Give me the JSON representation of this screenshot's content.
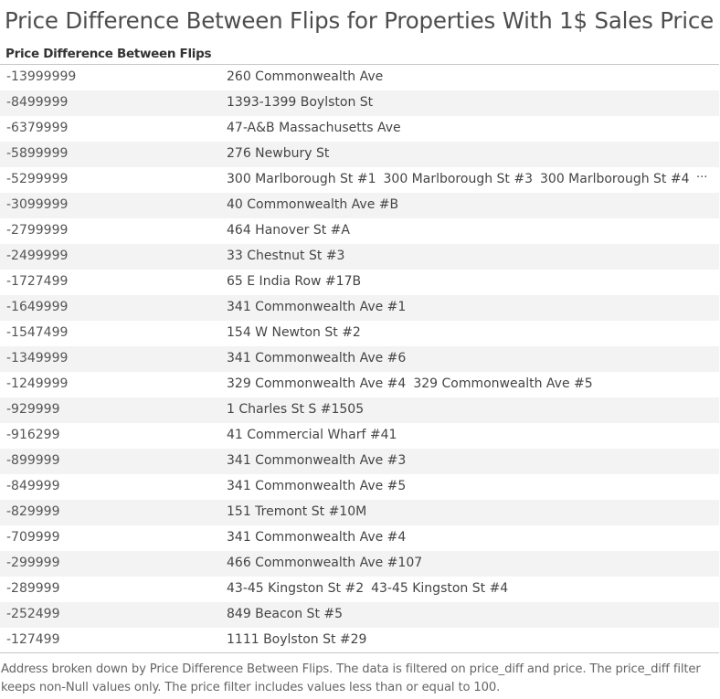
{
  "chart_data": {
    "type": "table",
    "title": "Price Difference Between Flips for Properties With 1$ Sales Price",
    "column_header": "Price Difference Between Flips",
    "rows": [
      {
        "diff": "-13999999",
        "addresses": [
          "260 Commonwealth Ave"
        ]
      },
      {
        "diff": "-8499999",
        "addresses": [
          "1393-1399 Boylston St"
        ]
      },
      {
        "diff": "-6379999",
        "addresses": [
          "47-A&B Massachusetts Ave"
        ]
      },
      {
        "diff": "-5899999",
        "addresses": [
          "276 Newbury St"
        ]
      },
      {
        "diff": "-5299999",
        "addresses": [
          "300 Marlborough St #1",
          "300 Marlborough St #3",
          "300 Marlborough St #4"
        ],
        "truncated": true
      },
      {
        "diff": "-3099999",
        "addresses": [
          "40 Commonwealth Ave #B"
        ]
      },
      {
        "diff": "-2799999",
        "addresses": [
          "464 Hanover St #A"
        ]
      },
      {
        "diff": "-2499999",
        "addresses": [
          "33 Chestnut St #3"
        ]
      },
      {
        "diff": "-1727499",
        "addresses": [
          "65 E India Row #17B"
        ]
      },
      {
        "diff": "-1649999",
        "addresses": [
          "341 Commonwealth Ave #1"
        ]
      },
      {
        "diff": "-1547499",
        "addresses": [
          "154 W Newton St #2"
        ]
      },
      {
        "diff": "-1349999",
        "addresses": [
          "341 Commonwealth Ave #6"
        ]
      },
      {
        "diff": "-1249999",
        "addresses": [
          "329 Commonwealth Ave #4",
          "329 Commonwealth Ave #5"
        ]
      },
      {
        "diff": "-929999",
        "addresses": [
          "1 Charles St S #1505"
        ]
      },
      {
        "diff": "-916299",
        "addresses": [
          "41 Commercial Wharf #41"
        ]
      },
      {
        "diff": "-899999",
        "addresses": [
          "341 Commonwealth Ave #3"
        ]
      },
      {
        "diff": "-849999",
        "addresses": [
          "341 Commonwealth Ave #5"
        ]
      },
      {
        "diff": "-829999",
        "addresses": [
          "151 Tremont St #10M"
        ]
      },
      {
        "diff": "-709999",
        "addresses": [
          "341 Commonwealth Ave #4"
        ]
      },
      {
        "diff": "-299999",
        "addresses": [
          "466 Commonwealth Ave #107"
        ]
      },
      {
        "diff": "-289999",
        "addresses": [
          "43-45 Kingston St #2",
          "43-45 Kingston St #4"
        ]
      },
      {
        "diff": "-252499",
        "addresses": [
          "849 Beacon St #5"
        ]
      },
      {
        "diff": "-127499",
        "addresses": [
          "1111 Boylston St #29"
        ]
      }
    ],
    "caption": "Address broken down by Price Difference Between Flips.  The data is filtered on price_diff and price. The price_diff filter keeps non-Null values only. The price filter includes values less than or equal to 100."
  },
  "more_icon": "ellipsis-icon",
  "more_glyph": "···"
}
